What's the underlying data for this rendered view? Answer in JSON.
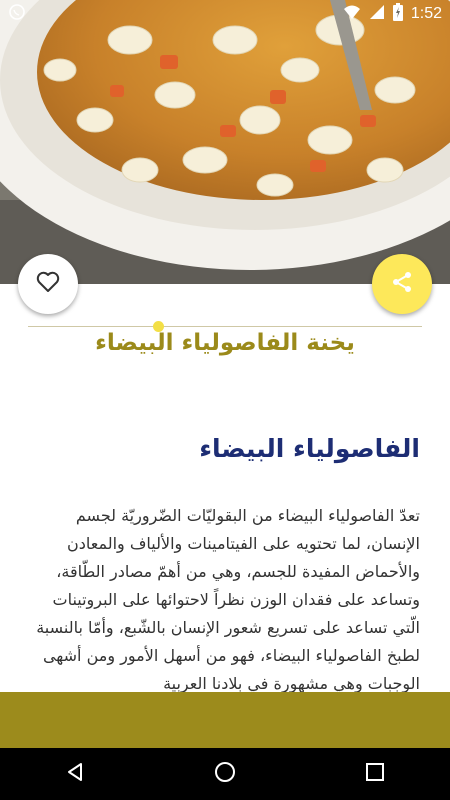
{
  "status_bar": {
    "time": "1:52",
    "icons": [
      "whatsapp-icon",
      "wifi-icon",
      "signal-icon",
      "battery-charging-icon"
    ]
  },
  "hero": {
    "image": "white-bean-stew-photo"
  },
  "actions": {
    "favorite_icon": "heart-outline-icon",
    "share_icon": "share-icon"
  },
  "recipe": {
    "title": "يخنة الفاصولياء البيضاء",
    "section_heading": "الفاصولياء البيضاء",
    "body": "تعدّ الفاصولياء البيضاء من البقوليّات الضّروريّة لجسم الإنسان، لما تحتويه على الفيتامينات والألياف والمعادن والأحماض المفيدة للجسم، وهي من أهمّ مصادر الطّاقة، وتساعد على فقدان الوزن نظراً لاحتوائها على البروتينات الّتي تساعد على تسريع شعور الإنسان بالشّبع، وأمّا بالنسبة لطبخ الفاصولياء البيضاء، فهو من أسهل الأمور ومن أشهى الوجبات وهي مشهورة في بلادنا العربية"
  },
  "nav_bar": {
    "back_icon": "back-triangle-icon",
    "home_icon": "home-circle-icon",
    "recents_icon": "recents-square-icon"
  },
  "colors": {
    "accent_yellow": "#fde85a",
    "title_gold": "#9b8a1a",
    "heading_navy": "#1d2d74",
    "bottom_band": "#9c8b1c"
  }
}
